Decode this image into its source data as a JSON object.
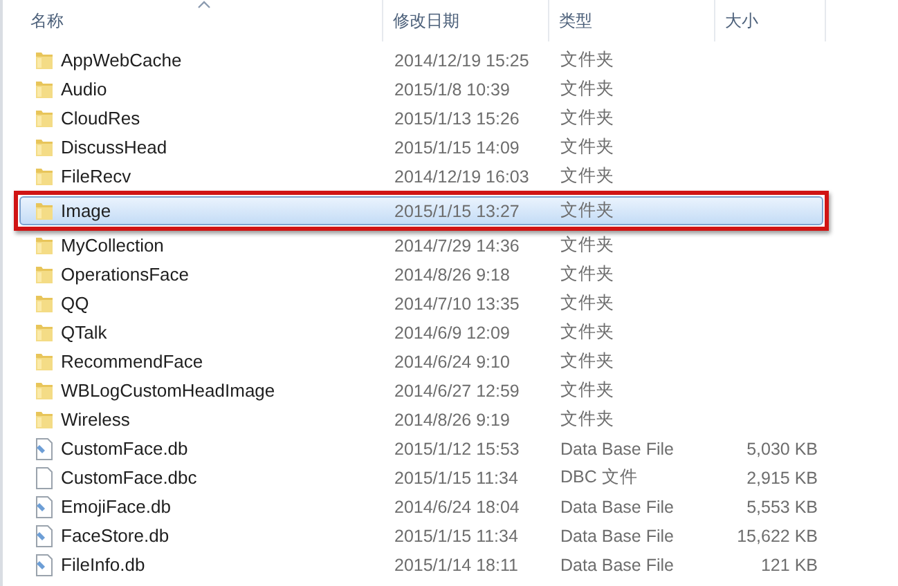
{
  "columns": [
    {
      "label": "名称",
      "sorted": true
    },
    {
      "label": "修改日期",
      "sorted": false
    },
    {
      "label": "类型",
      "sorted": false
    },
    {
      "label": "大小",
      "sorted": false
    }
  ],
  "rows": [
    {
      "kind": "folder",
      "name": "AppWebCache",
      "date": "2014/12/19 15:25",
      "type": "文件夹",
      "selected": false,
      "highlighted": false
    },
    {
      "kind": "folder",
      "name": "Audio",
      "date": "2015/1/8 10:39",
      "type": "文件夹",
      "selected": false,
      "highlighted": false
    },
    {
      "kind": "folder",
      "name": "CloudRes",
      "date": "2015/1/13 15:26",
      "type": "文件夹",
      "selected": false,
      "highlighted": false
    },
    {
      "kind": "folder",
      "name": "DiscussHead",
      "date": "2015/1/15 14:09",
      "type": "文件夹",
      "selected": false,
      "highlighted": false
    },
    {
      "kind": "folder",
      "name": "FileRecv",
      "date": "2014/12/19 16:03",
      "type": "文件夹",
      "selected": false,
      "highlighted": false
    },
    {
      "kind": "folder",
      "name": "Image",
      "date": "2015/1/15 13:27",
      "type": "文件夹",
      "selected": true,
      "highlighted": true
    },
    {
      "kind": "folder",
      "name": "MyCollection",
      "date": "2014/7/29 14:36",
      "type": "文件夹",
      "selected": false,
      "highlighted": false
    },
    {
      "kind": "folder",
      "name": "OperationsFace",
      "date": "2014/8/26 9:18",
      "type": "文件夹",
      "selected": false,
      "highlighted": false
    },
    {
      "kind": "folder",
      "name": "QQ",
      "date": "2014/7/10 13:35",
      "type": "文件夹",
      "selected": false,
      "highlighted": false
    },
    {
      "kind": "folder",
      "name": "QTalk",
      "date": "2014/6/9 12:09",
      "type": "文件夹",
      "selected": false,
      "highlighted": false
    },
    {
      "kind": "folder",
      "name": "RecommendFace",
      "date": "2014/6/24 9:10",
      "type": "文件夹",
      "selected": false,
      "highlighted": false
    },
    {
      "kind": "folder",
      "name": "WBLogCustomHeadImage",
      "date": "2014/6/27 12:59",
      "type": "文件夹",
      "selected": false,
      "highlighted": false
    },
    {
      "kind": "folder",
      "name": "Wireless",
      "date": "2014/8/26 9:19",
      "type": "文件夹",
      "selected": false,
      "highlighted": false
    },
    {
      "kind": "db",
      "name": "CustomFace.db",
      "date": "2015/1/12 15:53",
      "type": "Data Base File",
      "size": "5,030 KB",
      "selected": false,
      "highlighted": false
    },
    {
      "kind": "file",
      "name": "CustomFace.dbc",
      "date": "2015/1/15 11:34",
      "type": "DBC 文件",
      "size": "2,915 KB",
      "selected": false,
      "highlighted": false
    },
    {
      "kind": "db",
      "name": "EmojiFace.db",
      "date": "2014/6/24 18:04",
      "type": "Data Base File",
      "size": "5,553 KB",
      "selected": false,
      "highlighted": false
    },
    {
      "kind": "db",
      "name": "FaceStore.db",
      "date": "2015/1/15 11:34",
      "type": "Data Base File",
      "size": "15,622 KB",
      "selected": false,
      "highlighted": false
    },
    {
      "kind": "db",
      "name": "FileInfo.db",
      "date": "2015/1/14 18:11",
      "type": "Data Base File",
      "size": "121 KB",
      "selected": false,
      "highlighted": false
    }
  ]
}
